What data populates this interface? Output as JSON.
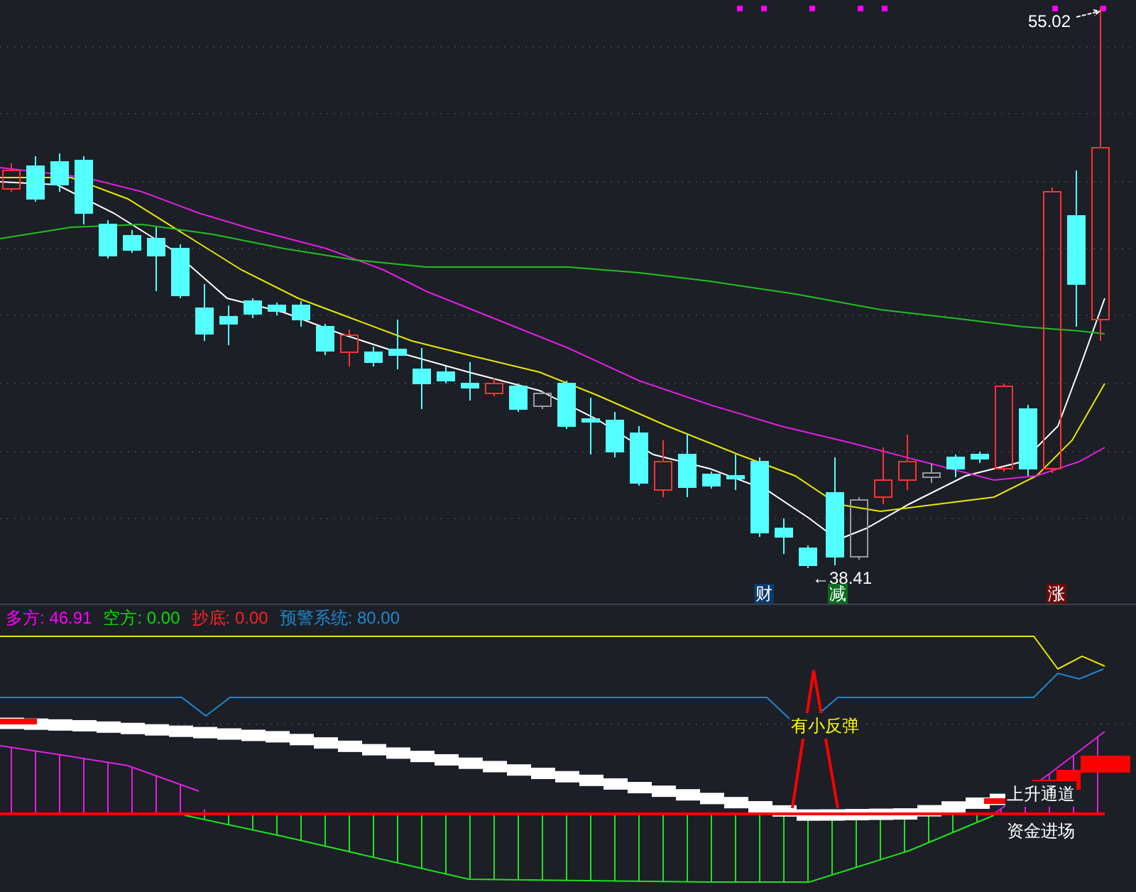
{
  "main_chart": {
    "high_label": "55.02",
    "low_label": "←38.41",
    "markers": [
      {
        "text": "财",
        "color": "#0b3a6b"
      },
      {
        "text": "减",
        "color": "#0b6b1c"
      },
      {
        "text": "涨",
        "color": "#6b0b0b"
      }
    ]
  },
  "indicator": {
    "legend": [
      {
        "label": "多方:",
        "value": "46.91",
        "color": "#ff00ff"
      },
      {
        "label": "空方:",
        "value": "0.00",
        "color": "#00e000"
      },
      {
        "label": "抄底:",
        "value": "0.00",
        "color": "#ff2020"
      },
      {
        "label": "预警系统:",
        "value": "80.00",
        "color": "#1e88d0"
      }
    ],
    "annotations": [
      {
        "text": "有小反弹",
        "color": "#ffff00"
      },
      {
        "text": "上升通道",
        "color": "#ffffff"
      },
      {
        "text": "资金进场",
        "color": "#ffffff"
      }
    ]
  }
}
